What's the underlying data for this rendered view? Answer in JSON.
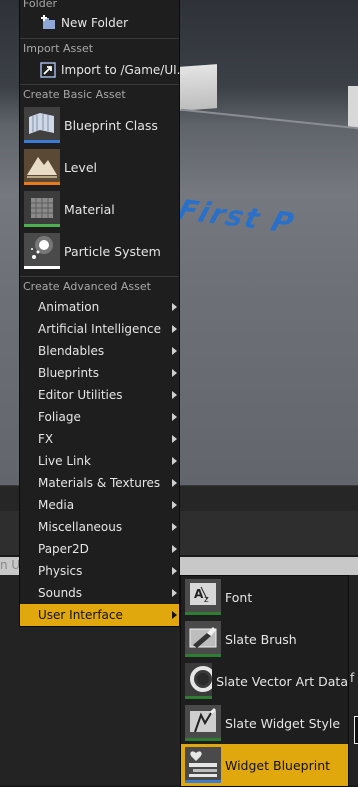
{
  "background": {
    "viewport_text": "First P",
    "search_fragment": "n UI",
    "right_fragment": "f"
  },
  "menu": {
    "sections": {
      "folder": "Folder",
      "import_asset": "Import Asset",
      "create_basic_asset": "Create Basic Asset",
      "create_advanced_asset": "Create Advanced Asset"
    },
    "new_folder": {
      "label": "New Folder",
      "icon": "new-folder-icon"
    },
    "import": {
      "label": "Import to /Game/UI...",
      "icon": "import-icon"
    },
    "basic_assets": [
      {
        "label": "Blueprint Class",
        "icon": "blueprint-class-icon",
        "color": "#3a7bd5"
      },
      {
        "label": "Level",
        "icon": "level-icon",
        "color": "#e87b1c"
      },
      {
        "label": "Material",
        "icon": "material-icon",
        "color": "#4caf50"
      },
      {
        "label": "Particle System",
        "icon": "particle-system-icon",
        "color": "#ffffff"
      }
    ],
    "advanced_categories": [
      "Animation",
      "Artificial Intelligence",
      "Blendables",
      "Blueprints",
      "Editor Utilities",
      "Foliage",
      "FX",
      "Live Link",
      "Materials & Textures",
      "Media",
      "Miscellaneous",
      "Paper2D",
      "Physics",
      "Sounds",
      "User Interface"
    ],
    "active_category": "User Interface"
  },
  "submenu": {
    "items": [
      {
        "label": "Font",
        "icon": "font-icon"
      },
      {
        "label": "Slate Brush",
        "icon": "slate-brush-icon"
      },
      {
        "label": "Slate Vector Art Data",
        "icon": "slate-vector-art-icon"
      },
      {
        "label": "Slate Widget Style",
        "icon": "slate-widget-style-icon"
      },
      {
        "label": "Widget Blueprint",
        "icon": "widget-blueprint-icon"
      }
    ],
    "active_item": "Widget Blueprint"
  },
  "colors": {
    "highlight": "#e0a80d",
    "menu_bg": "#1e1e1e",
    "section_text": "#a8a8a8"
  }
}
